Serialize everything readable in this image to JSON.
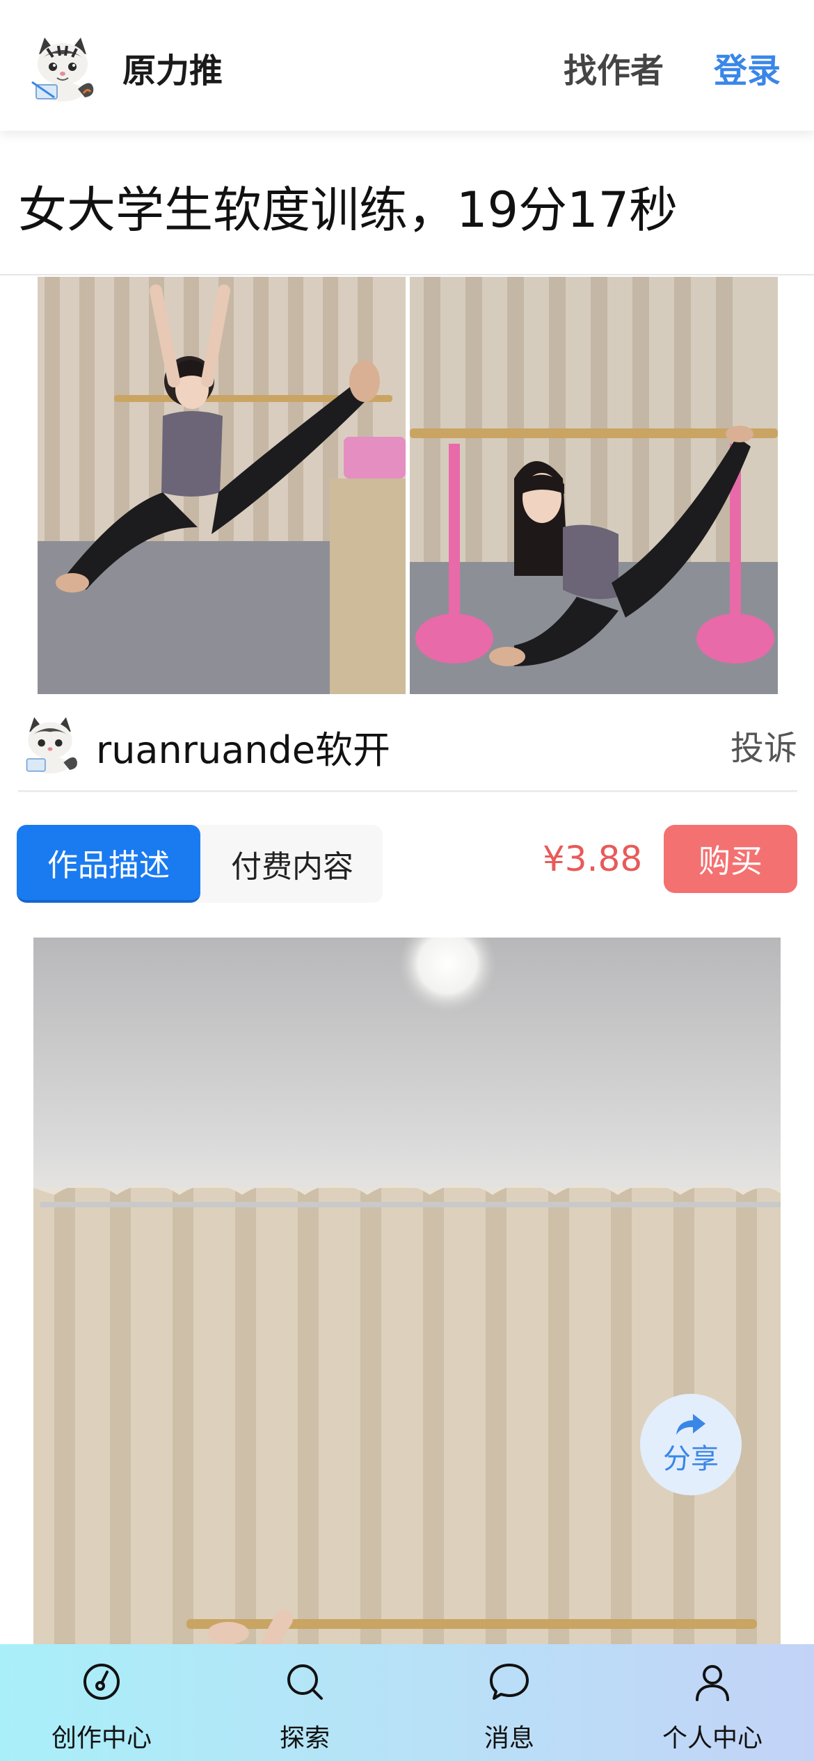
{
  "header": {
    "app_name": "原力推",
    "find_author_label": "找作者",
    "login_label": "登录"
  },
  "post": {
    "title": "女大学生软度训练，19分17秒"
  },
  "author": {
    "name": "ruanruande软开",
    "report_label": "投诉"
  },
  "tabs": [
    {
      "label": "作品描述",
      "active": true
    },
    {
      "label": "付费内容",
      "active": false
    }
  ],
  "purchase": {
    "price": "¥3.88",
    "buy_label": "购买"
  },
  "share": {
    "label": "分享"
  },
  "bottom_nav": {
    "items": [
      {
        "label": "创作中心",
        "icon": "dashboard-icon"
      },
      {
        "label": "探索",
        "icon": "search-icon"
      },
      {
        "label": "消息",
        "icon": "message-icon"
      },
      {
        "label": "个人中心",
        "icon": "user-icon"
      }
    ]
  },
  "colors": {
    "accent_blue": "#1a7bf0",
    "price_red": "#e85a5a",
    "buy_button": "#f47171",
    "login_blue": "#3a86e8"
  }
}
